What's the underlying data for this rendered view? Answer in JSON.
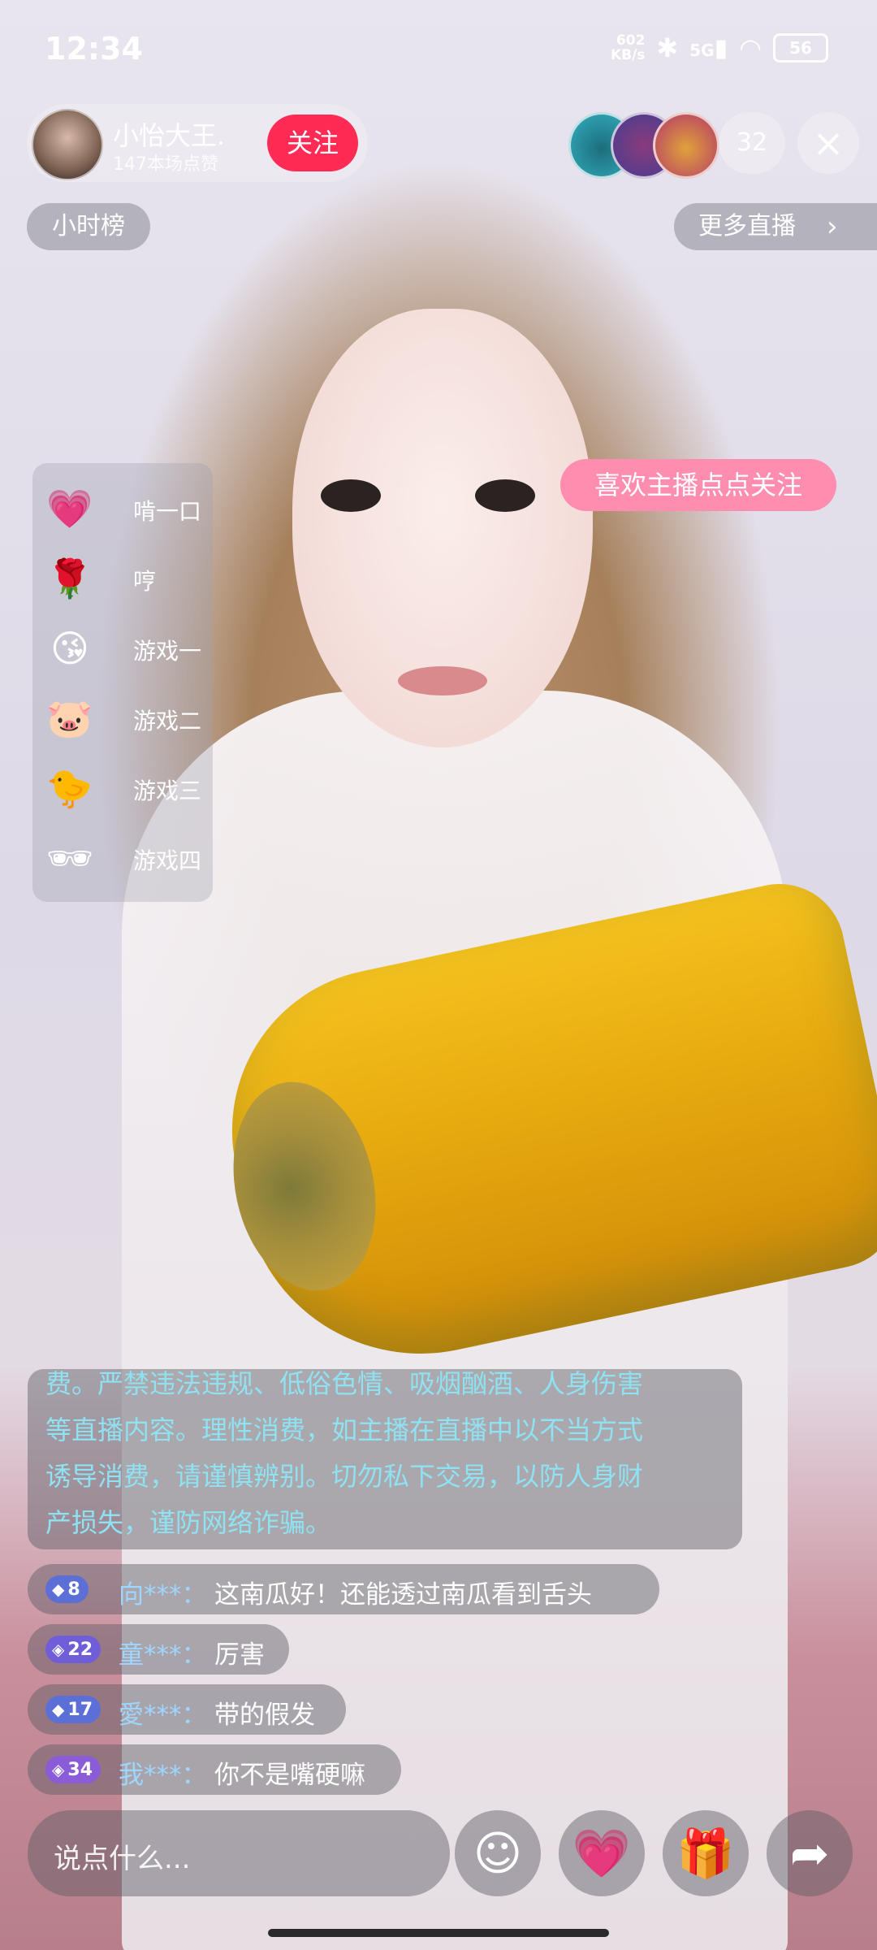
{
  "status_bar": {
    "time": "12:34",
    "net_speed_value": "602",
    "net_speed_unit": "KB/s",
    "signal_type": "5G",
    "battery": "56"
  },
  "host": {
    "name": "小怡大王.",
    "likes": "147本场点赞",
    "follow_label": "关注"
  },
  "viewer_count": "32",
  "close_icon": "×",
  "rank_label": "小时榜",
  "more_live_label": "更多直播",
  "follow_prompt": "喜欢主播点点关注",
  "gifts": [
    {
      "icon": "heart-icon",
      "glyph": "💗",
      "label": "啃一口"
    },
    {
      "icon": "rose-icon",
      "glyph": "🌹",
      "label": "哼"
    },
    {
      "icon": "face-icon",
      "glyph": "😘",
      "label": "游戏一"
    },
    {
      "icon": "pig-icon",
      "glyph": "🐷",
      "label": "游戏二"
    },
    {
      "icon": "duck-icon",
      "glyph": "🐤",
      "label": "游戏三"
    },
    {
      "icon": "sunglasses-icon",
      "glyph": "🕶",
      "label": "游戏四"
    }
  ],
  "notice_lines": [
    "费。严禁违法违规、低俗色情、吸烟酗酒、人身伤害",
    "等直播内容。理性消费，如主播在直播中以不当方式",
    "诱导消费，请谨慎辨别。切勿私下交易，以防人身财",
    "产损失，谨防网络诈骗。"
  ],
  "comments": [
    {
      "level": "8",
      "badge_color": "#5b6fd6",
      "user": "向***：",
      "message": "这南瓜好！还能透过南瓜看到舌头"
    },
    {
      "level": "22",
      "badge_color": "#6f5ed8",
      "user": "童***：",
      "message": "厉害"
    },
    {
      "level": "17",
      "badge_color": "#5b6fd6",
      "user": "愛***：",
      "message": "带的假发"
    },
    {
      "level": "34",
      "badge_color": "#8a5cd8",
      "user": "我***：",
      "message": "你不是嘴硬嘛"
    }
  ],
  "input_placeholder": "说点什么...",
  "bottom_buttons": [
    {
      "name": "emoji-button",
      "glyph": "☺"
    },
    {
      "name": "like-heart-button",
      "glyph": "💗"
    },
    {
      "name": "gift-button",
      "glyph": "🎁"
    },
    {
      "name": "share-button",
      "glyph": "➦"
    }
  ]
}
